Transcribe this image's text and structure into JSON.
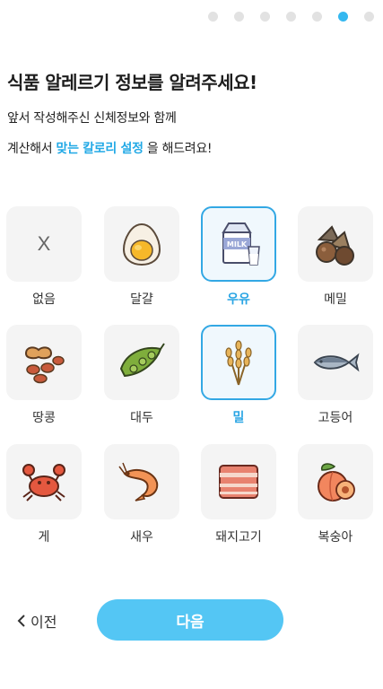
{
  "progress": {
    "total_steps": 7,
    "current_step": 6
  },
  "header": {
    "title": "식품 알레르기 정보를 알려주세요!",
    "subtitle_line1": "앞서 작성해주신 신체정보와 함께",
    "subtitle_line2_prefix": "계산해서 ",
    "subtitle_line2_highlight": "맞는 칼로리 설정",
    "subtitle_line2_suffix": " 을 해드려요!"
  },
  "allergy_options": [
    {
      "label": "없음",
      "icon": "x-icon",
      "selected": false,
      "none_mark": "X"
    },
    {
      "label": "달걀",
      "icon": "egg-icon",
      "selected": false
    },
    {
      "label": "우유",
      "icon": "milk-icon",
      "selected": true,
      "icon_text": "MILK"
    },
    {
      "label": "메밀",
      "icon": "buckwheat-icon",
      "selected": false
    },
    {
      "label": "땅콩",
      "icon": "peanut-icon",
      "selected": false
    },
    {
      "label": "대두",
      "icon": "soybean-icon",
      "selected": false
    },
    {
      "label": "밀",
      "icon": "wheat-icon",
      "selected": true
    },
    {
      "label": "고등어",
      "icon": "mackerel-icon",
      "selected": false
    },
    {
      "label": "게",
      "icon": "crab-icon",
      "selected": false
    },
    {
      "label": "새우",
      "icon": "shrimp-icon",
      "selected": false
    },
    {
      "label": "돼지고기",
      "icon": "pork-icon",
      "selected": false
    },
    {
      "label": "복숭아",
      "icon": "peach-icon",
      "selected": false
    }
  ],
  "footer": {
    "prev_label": "이전",
    "next_label": "다음"
  },
  "colors": {
    "accent": "#35b8f0",
    "button": "#54c6f4",
    "selected_border": "#33a8e4"
  }
}
